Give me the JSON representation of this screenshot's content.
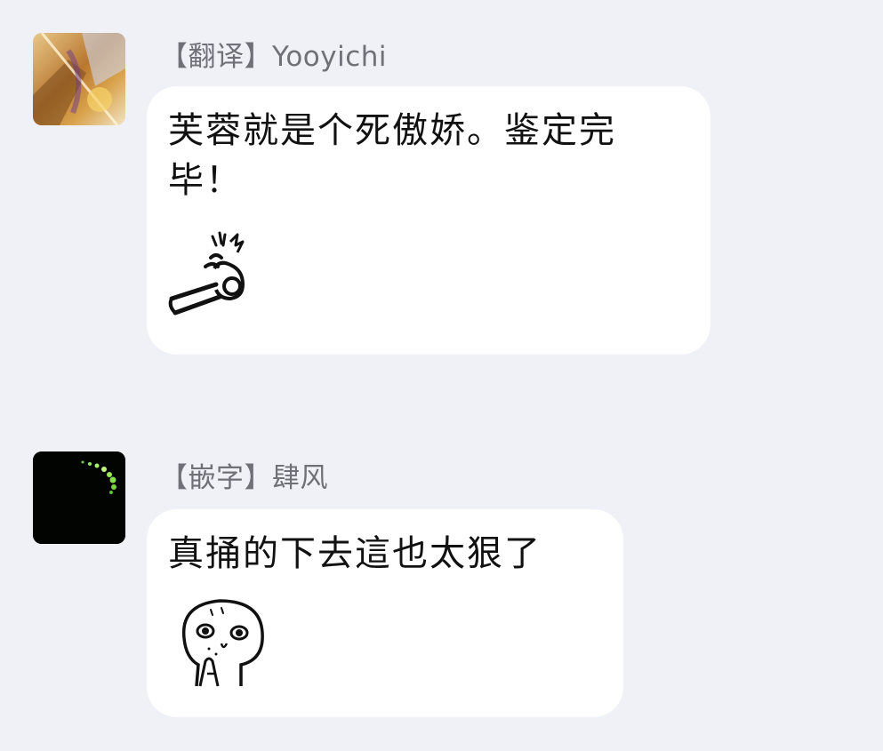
{
  "messages": [
    {
      "tag": "【翻译】",
      "sender": "Yooyichi",
      "text_line1": "芙蓉就是个死傲娇。鉴定完",
      "text_line2": "毕！",
      "sticker": "fist-punch-sticker"
    },
    {
      "tag": "【嵌字】",
      "sender": "肆风",
      "text_line1": "真捅的下去這也太狠了",
      "sticker": "nervous-blob-sticker"
    }
  ],
  "colors": {
    "background": "#f0f1f6",
    "bubble": "#ffffff",
    "sender_text": "#6f7078",
    "message_text": "#111111"
  }
}
